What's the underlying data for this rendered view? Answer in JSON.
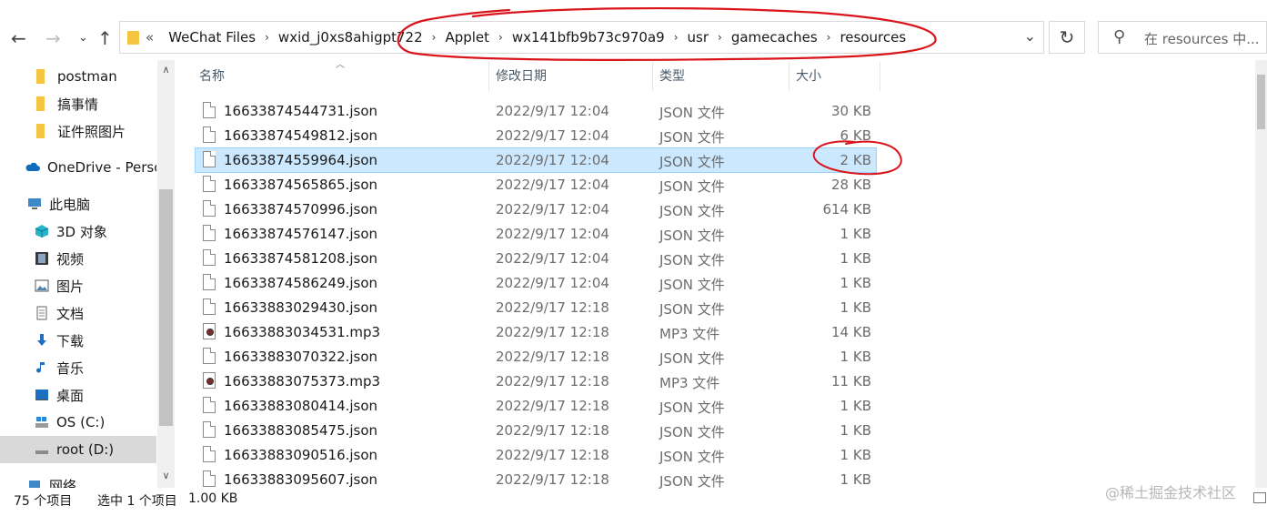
{
  "nav": {
    "back_icon": "arrow-left-icon",
    "forward_icon": "arrow-right-icon",
    "recent_icon": "chevron-down-icon",
    "up_icon": "arrow-up-icon"
  },
  "address": {
    "overflow": "«",
    "crumbs": [
      "WeChat Files",
      "wxid_j0xs8ahigpt722",
      "Applet",
      "wx141bfb9b73c970a9",
      "usr",
      "gamecaches",
      "resources"
    ]
  },
  "search": {
    "placeholder": "在 resources 中..."
  },
  "sidebar": {
    "items": [
      {
        "label": "postman",
        "icon": "folder-icon"
      },
      {
        "label": "搞事情",
        "icon": "folder-icon"
      },
      {
        "label": "证件照图片",
        "icon": "folder-icon"
      },
      {
        "label": "OneDrive - Perso",
        "icon": "cloud-icon"
      },
      {
        "label": "此电脑",
        "icon": "computer-icon"
      },
      {
        "label": "3D 对象",
        "icon": "cube-icon"
      },
      {
        "label": "视频",
        "icon": "video-icon"
      },
      {
        "label": "图片",
        "icon": "picture-icon"
      },
      {
        "label": "文档",
        "icon": "document-icon"
      },
      {
        "label": "下载",
        "icon": "download-icon"
      },
      {
        "label": "音乐",
        "icon": "music-icon"
      },
      {
        "label": "桌面",
        "icon": "desktop-icon"
      },
      {
        "label": "OS (C:)",
        "icon": "drive-icon"
      },
      {
        "label": "root (D:)",
        "icon": "drive-icon"
      },
      {
        "label": "网络",
        "icon": "network-icon"
      }
    ]
  },
  "columns": {
    "name": "名称",
    "date": "修改日期",
    "type": "类型",
    "size": "大小"
  },
  "files": [
    {
      "name": "16633874544731.json",
      "date": "2022/9/17 12:04",
      "type": "JSON 文件",
      "size": "30 KB"
    },
    {
      "name": "16633874549812.json",
      "date": "2022/9/17 12:04",
      "type": "JSON 文件",
      "size": "6 KB"
    },
    {
      "name": "16633874559964.json",
      "date": "2022/9/17 12:04",
      "type": "JSON 文件",
      "size": "2 KB"
    },
    {
      "name": "16633874565865.json",
      "date": "2022/9/17 12:04",
      "type": "JSON 文件",
      "size": "28 KB"
    },
    {
      "name": "16633874570996.json",
      "date": "2022/9/17 12:04",
      "type": "JSON 文件",
      "size": "614 KB"
    },
    {
      "name": "16633874576147.json",
      "date": "2022/9/17 12:04",
      "type": "JSON 文件",
      "size": "1 KB"
    },
    {
      "name": "16633874581208.json",
      "date": "2022/9/17 12:04",
      "type": "JSON 文件",
      "size": "1 KB"
    },
    {
      "name": "16633874586249.json",
      "date": "2022/9/17 12:04",
      "type": "JSON 文件",
      "size": "1 KB"
    },
    {
      "name": "16633883029430.json",
      "date": "2022/9/17 12:18",
      "type": "JSON 文件",
      "size": "1 KB"
    },
    {
      "name": "16633883034531.mp3",
      "date": "2022/9/17 12:18",
      "type": "MP3 文件",
      "size": "14 KB"
    },
    {
      "name": "16633883070322.json",
      "date": "2022/9/17 12:18",
      "type": "JSON 文件",
      "size": "1 KB"
    },
    {
      "name": "16633883075373.mp3",
      "date": "2022/9/17 12:18",
      "type": "MP3 文件",
      "size": "11 KB"
    },
    {
      "name": "16633883080414.json",
      "date": "2022/9/17 12:18",
      "type": "JSON 文件",
      "size": "1 KB"
    },
    {
      "name": "16633883085475.json",
      "date": "2022/9/17 12:18",
      "type": "JSON 文件",
      "size": "1 KB"
    },
    {
      "name": "16633883090516.json",
      "date": "2022/9/17 12:18",
      "type": "JSON 文件",
      "size": "1 KB"
    },
    {
      "name": "16633883095607.json",
      "date": "2022/9/17 12:18",
      "type": "JSON 文件",
      "size": "1 KB"
    }
  ],
  "selected_file_index": 2,
  "status": {
    "count": "75 个项目",
    "selection": "选中 1 个项目",
    "size": "1.00 KB"
  },
  "watermark": "@稀土掘金技术社区",
  "colors": {
    "selection": "#cce8ff",
    "annotation": "#d9151b",
    "folder": "#f5c542"
  }
}
